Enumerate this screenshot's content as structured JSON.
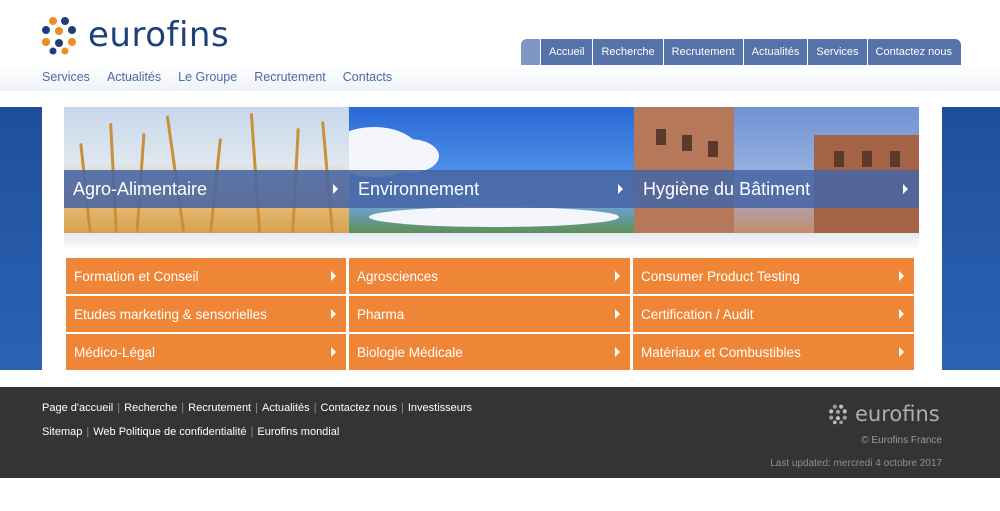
{
  "brand": {
    "name": "eurofins"
  },
  "top_tabs": [
    "Accueil",
    "Recherche",
    "Recrutement",
    "Actualités",
    "Services",
    "Contactez nous"
  ],
  "sub_nav": [
    "Services",
    "Actualités",
    "Le Groupe",
    "Recrutement",
    "Contacts"
  ],
  "hero_panels": [
    {
      "title": "Agro-Alimentaire",
      "image": "wheat-field"
    },
    {
      "title": "Environnement",
      "image": "sky-clouds"
    },
    {
      "title": "Hygiène du Bâtiment",
      "image": "brick-building"
    }
  ],
  "categories": [
    [
      "Formation et Conseil",
      "Agrosciences",
      "Consumer Product Testing"
    ],
    [
      "Etudes marketing & sensorielles",
      "Pharma",
      "Certification / Audit"
    ],
    [
      "Médico-Légal",
      "Biologie Médicale",
      "Matériaux et Combustibles"
    ]
  ],
  "footer": {
    "links_row1": [
      "Page d'accueil",
      "Recherche",
      "Recrutement",
      "Actualités",
      "Contactez nous",
      "Investisseurs"
    ],
    "links_row2": [
      "Sitemap",
      "Web Politique de confidentialité",
      "Eurofins mondial"
    ],
    "logo_text": "eurofins",
    "copyright": "© Eurofins France",
    "last_updated": "Last updated: mercredi 4 octobre 2017"
  },
  "colors": {
    "brand_blue": "#1d3f7a",
    "tab_blue": "#5573a9",
    "link_blue": "#4d6aa3",
    "orange": "#ee8537",
    "footer_bg": "#343434",
    "side_band": "#1e4f9c"
  },
  "icons": [
    "eurofins-logo-icon",
    "chevron-right-icon"
  ]
}
